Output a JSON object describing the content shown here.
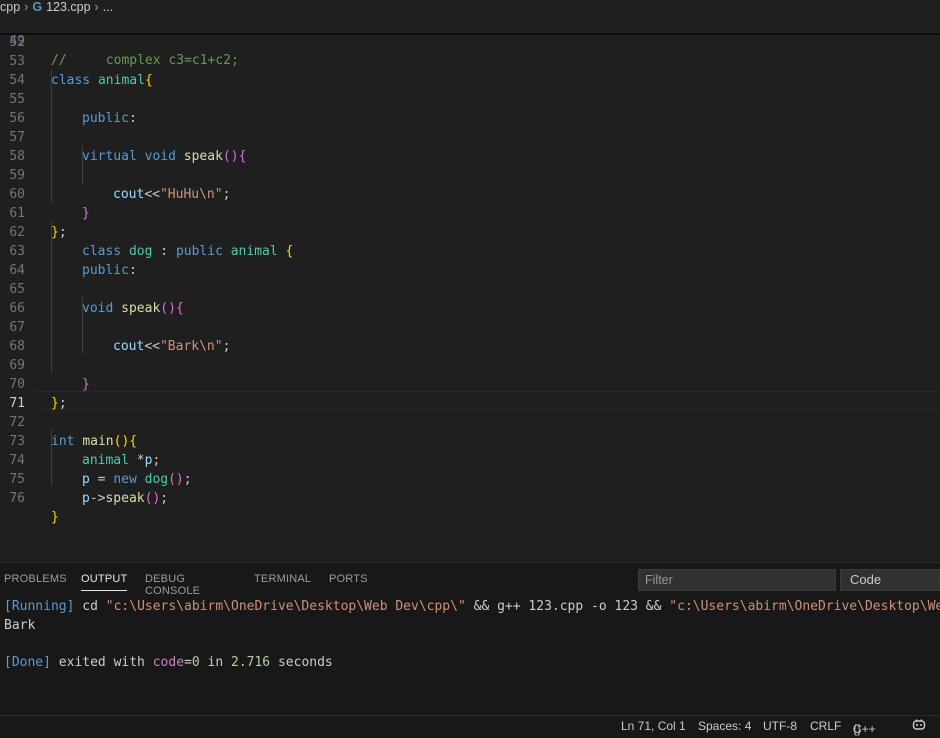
{
  "breadcrumb": {
    "folder": "cpp",
    "file": "123.cpp",
    "more": "..."
  },
  "editor": {
    "sticky_line": {
      "number": "49",
      "text": "//     complex c3=c1+c2;"
    },
    "line_numbers": [
      "52",
      "53",
      "54",
      "55",
      "56",
      "57",
      "58",
      "59",
      "60",
      "61",
      "62",
      "63",
      "64",
      "65",
      "66",
      "67",
      "68",
      "69",
      "70",
      "71",
      "72",
      "73",
      "74",
      "75",
      "76"
    ],
    "active_line": "71"
  },
  "code": {
    "l53_kw": "class",
    "l53_name": "animal",
    "l53_brace": "{",
    "l55_kw": "public",
    "l55_colon": ":",
    "l57_kw1": "virtual",
    "l57_kw2": "void",
    "l57_fn": "speak",
    "l57_paren": "()",
    "l57_brace": "{",
    "l59_var": "cout",
    "l59_op": "<<",
    "l59_str": "\"HuHu\\n\"",
    "l59_semi": ";",
    "l60_brace": "}",
    "l61_brace": "}",
    "l61_semi": ";",
    "l62_kw": "class",
    "l62_name": "dog",
    "l62_colon": " : ",
    "l62_kw2": "public",
    "l62_base": "animal",
    "l62_brace": "{",
    "l63_kw": "public",
    "l63_colon": ":",
    "l65_kw": "void",
    "l65_fn": "speak",
    "l65_paren": "()",
    "l65_brace": "{",
    "l67_var": "cout",
    "l67_op": "<<",
    "l67_str": "\"Bark\\n\"",
    "l67_semi": ";",
    "l69_brace": "}",
    "l70_brace": "}",
    "l70_semi": ";",
    "l72_kw": "int",
    "l72_fn": "main",
    "l72_paren": "()",
    "l72_brace": "{",
    "l73_type": "animal",
    "l73_rest": " *",
    "l73_var": "p",
    "l73_semi": ";",
    "l74_var": "p",
    "l74_op": " = ",
    "l74_kw": "new",
    "l74_type": "dog",
    "l74_paren": "()",
    "l74_semi": ";",
    "l75_var": "p",
    "l75_arrow": "->",
    "l75_fn": "speak",
    "l75_paren": "()",
    "l75_semi": ";",
    "l76_brace": "}"
  },
  "panel": {
    "tabs": [
      "PROBLEMS",
      "OUTPUT",
      "DEBUG CONSOLE",
      "TERMINAL",
      "PORTS"
    ],
    "active_tab": "OUTPUT",
    "filter_placeholder": "Filter",
    "channel": "Code",
    "output": {
      "running_tag": "[Running]",
      "cmd_cd": " cd ",
      "path1": "\"c:\\Users\\abirm\\OneDrive\\Desktop\\Web Dev\\cpp\\\"",
      "cmd_mid": " && g++ 123.cpp -o 123 && ",
      "path2": "\"c:\\Users\\abirm\\OneDrive\\Desktop\\Web D",
      "program_output": "Bark",
      "done_tag": "[Done]",
      "done_text1": " exited with ",
      "code_kw": "code",
      "code_eq": "=",
      "code_val": "0",
      "done_text2": " in ",
      "seconds_val": "2.716",
      "done_text3": " seconds"
    }
  },
  "status_bar": {
    "position": "Ln 71, Col 1",
    "spaces": "Spaces: 4",
    "encoding": "UTF-8",
    "eol": "CRLF",
    "language_braces": "{}",
    "language": "C++",
    "copilot_icon": "copilot-icon"
  }
}
